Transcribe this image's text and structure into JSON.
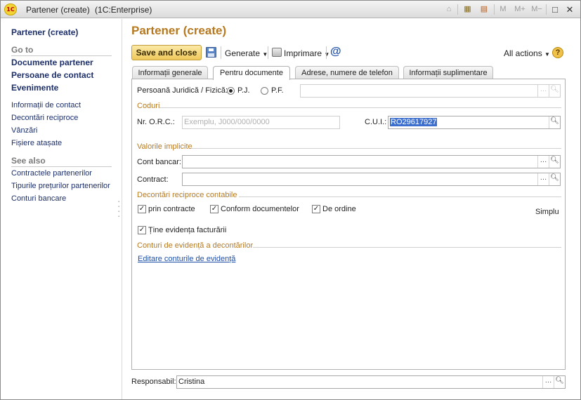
{
  "window": {
    "app_logo": "1C",
    "title": "Partener (create)",
    "subtitle": "(1C:Enterprise)",
    "toolbar_buttons": [
      "M",
      "M+",
      "M−"
    ]
  },
  "sidebar": {
    "title": "Partener (create)",
    "goto_header": "Go to",
    "goto_bold": [
      "Documente partener",
      "Persoane de contact",
      "Evenimente"
    ],
    "goto_links": [
      "Informații de contact",
      "Decontări reciproce",
      "Vânzări",
      "Fișiere atașate"
    ],
    "seealso_header": "See also",
    "seealso_links": [
      "Contractele partenerilor",
      "Tipurile prețurilor partenerilor",
      "Conturi bancare"
    ]
  },
  "form": {
    "title": "Partener (create)",
    "save_close_label": "Save and close",
    "generate_label": "Generate",
    "print_label": "Imprimare",
    "all_actions_label": "All actions",
    "help_label": "?"
  },
  "tabs": [
    {
      "label": "Informații generale",
      "active": false
    },
    {
      "label": "Pentru documente",
      "active": true
    },
    {
      "label": "Adrese, numere de telefon",
      "active": false
    },
    {
      "label": "Informații suplimentare",
      "active": false
    }
  ],
  "panel": {
    "person_type_label": "Persoană Juridică / Fizică:",
    "pj_label": "P.J.",
    "pf_label": "P.F.",
    "pj_selected": true,
    "codes_header": "Coduri",
    "orc_label": "Nr. O.R.C.:",
    "orc_placeholder": "Exemplu, J000/000/0000",
    "cui_label": "C.U.I.:",
    "cui_value": "RO29617927",
    "defaults_header": "Valorile implicite",
    "bank_account_label": "Cont bancar:",
    "contract_label": "Contract:",
    "settlements_header": "Decontări reciproce contabile",
    "chk_contracts_label": "prin contracte",
    "chk_documents_label": "Conform documentelor",
    "chk_order_label": "De ordine",
    "simplu_label": "Simplu",
    "chk_invoices_label": "Ține evidența facturării",
    "accounts_header": "Conturi de evidență a decontărilor",
    "edit_accounts_link": "Editare conturile de evidență"
  },
  "footer": {
    "responsible_label": "Responsabil:",
    "responsible_value": "Cristina"
  }
}
